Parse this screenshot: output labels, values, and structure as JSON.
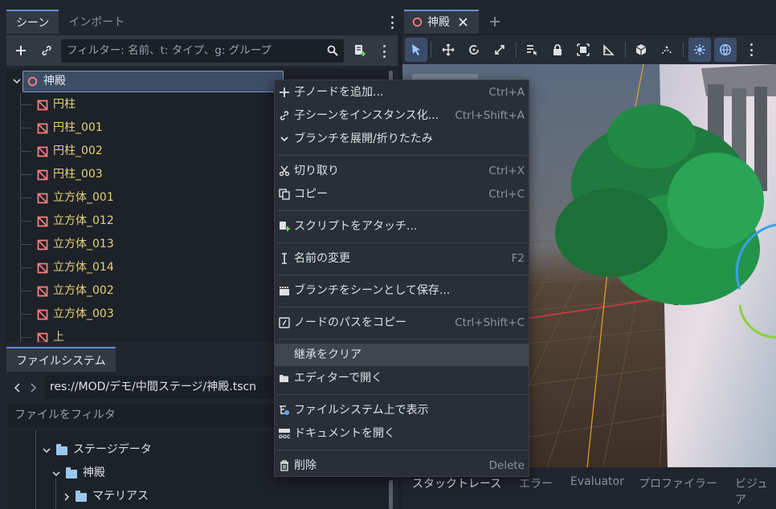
{
  "scene_dock": {
    "tabs": [
      "シーン",
      "インポート"
    ],
    "filter_placeholder": "フィルター: 名前、t: タイプ、g: グループ",
    "root": "神殿",
    "nodes": [
      "円柱",
      "円柱_001",
      "円柱_002",
      "円柱_003",
      "立方体_001",
      "立方体_012",
      "立方体_013",
      "立方体_014",
      "立方体_002",
      "立方体_003",
      "上"
    ]
  },
  "filesystem_dock": {
    "tab": "ファイルシステム",
    "path": "res://MOD/デモ/中間ステージ/神殿.tscn",
    "filter_placeholder": "ファイルをフィルタ",
    "items": [
      "ステージデータ",
      "神殿",
      "マテリアス"
    ]
  },
  "editor": {
    "scene_tab": "神殿",
    "bottom_tabs": [
      "スタックトレース",
      "エラー",
      "Evaluator",
      "プロファイラー",
      "ビジュア"
    ]
  },
  "context_menu": {
    "items": [
      {
        "label": "子ノードを追加...",
        "shortcut": "Ctrl+A",
        "icon": "plus-icon"
      },
      {
        "label": "子シーンをインスタンス化...",
        "shortcut": "Ctrl+Shift+A",
        "icon": "link-icon"
      },
      {
        "label": "ブランチを展開/折りたたみ",
        "shortcut": "",
        "icon": "chevron-down-icon"
      },
      {
        "label": "切り取り",
        "shortcut": "Ctrl+X",
        "icon": "scissors-icon"
      },
      {
        "label": "コピー",
        "shortcut": "Ctrl+C",
        "icon": "copy-icon"
      },
      {
        "label": "スクリプトをアタッチ...",
        "shortcut": "",
        "icon": "script-add-icon"
      },
      {
        "label": "名前の変更",
        "shortcut": "F2",
        "icon": "text-cursor-icon"
      },
      {
        "label": "ブランチをシーンとして保存...",
        "shortcut": "",
        "icon": "save-scene-icon"
      },
      {
        "label": "ノードのパスをコピー",
        "shortcut": "Ctrl+Shift+C",
        "icon": "node-path-icon"
      },
      {
        "label": "継承をクリア",
        "shortcut": "",
        "icon": ""
      },
      {
        "label": "エディターで開く",
        "shortcut": "",
        "icon": "folder-open-icon"
      },
      {
        "label": "ファイルシステム上で表示",
        "shortcut": "",
        "icon": "filesystem-icon"
      },
      {
        "label": "ドキュメントを開く",
        "shortcut": "",
        "icon": "doc-icon"
      },
      {
        "label": "削除",
        "shortcut": "Delete",
        "icon": "trash-icon"
      }
    ]
  }
}
